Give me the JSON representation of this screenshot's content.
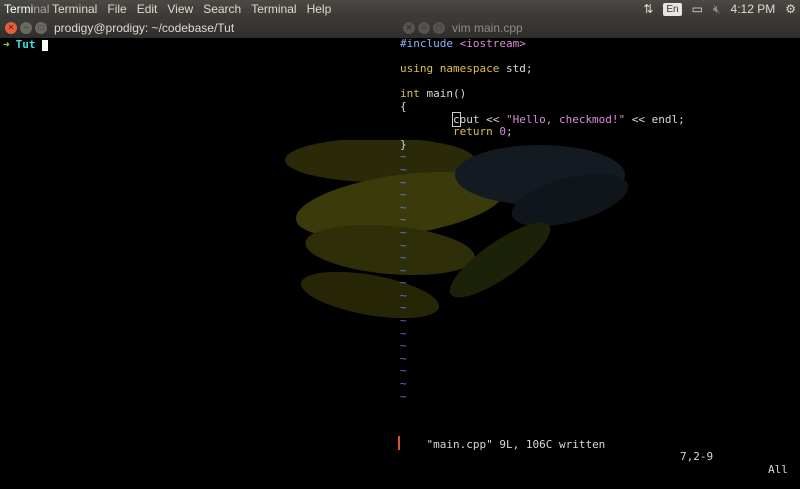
{
  "menubar": {
    "app_name_bright": "Termi",
    "app_name_dim": "nal",
    "menus": [
      "Terminal",
      "File",
      "Edit",
      "View",
      "Search",
      "Terminal",
      "Help"
    ],
    "lang": "En",
    "clock": "4:12 PM"
  },
  "left_window": {
    "title": "prodigy@prodigy: ~/codebase/Tut",
    "prompt_arrow": "➜",
    "prompt_dir": "Tut"
  },
  "right_window": {
    "title": "vim main.cpp",
    "status": "\"main.cpp\" 9L, 106C written",
    "position": "7,2-9",
    "scroll": "All"
  },
  "colors": {
    "accent_close": "#e0603a",
    "prompt_arrow": "#8ae234",
    "prompt_dir": "#34e2e2",
    "vim_tilde": "#5f7dd3",
    "vim_keyword": "#ddc04a",
    "vim_string": "#d98cd9"
  }
}
